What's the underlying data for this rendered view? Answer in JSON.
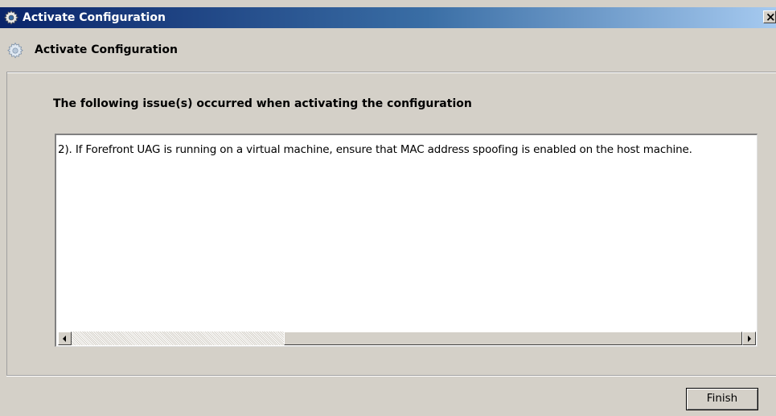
{
  "window": {
    "title": "Activate Configuration",
    "close_glyph": "×",
    "app_icon": "gear-icon"
  },
  "header": {
    "title": "Activate Configuration",
    "icon": "gear-icon"
  },
  "content": {
    "heading": "The following issue(s) occurred when activating the configuration",
    "message": "2). If Forefront UAG is running on a virtual machine, ensure that MAC address spoofing is enabled on the host machine."
  },
  "footer": {
    "finish_label": "Finish"
  },
  "colors": {
    "titlebar_start": "#0a246a",
    "titlebar_end": "#a6caf0",
    "window_bg": "#d4d0c8"
  }
}
